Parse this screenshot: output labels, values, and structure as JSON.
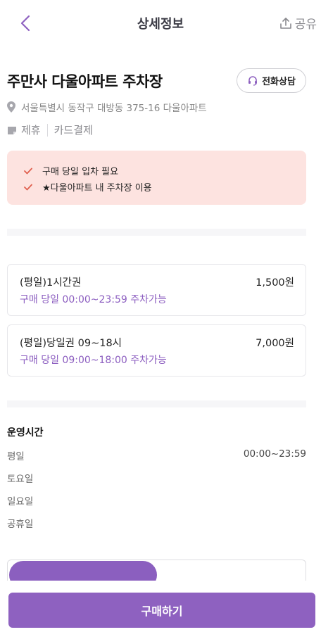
{
  "header": {
    "title": "상세정보",
    "share_label": "공유"
  },
  "place": {
    "name": "주만사 다울아파트 주차장",
    "call_label": "전화상담",
    "address": "서울특별시 동작구 대방동 375-16 다울아파트",
    "tags": [
      "제휴",
      "카드결제"
    ]
  },
  "notices": [
    "구매 당일 입차 필요",
    "★다울아파트 내 주차장 이용"
  ],
  "tickets": [
    {
      "name": "(평일)1시간권",
      "price": "1,500원",
      "desc": "구매 당일 00:00~23:59 주차가능"
    },
    {
      "name": "(평일)당일권 09~18시",
      "price": "7,000원",
      "desc": "구매 당일 09:00~18:00 주차가능"
    }
  ],
  "hours": {
    "title": "운영시간",
    "rows": [
      {
        "day": "평일",
        "time": "00:00~23:59"
      },
      {
        "day": "토요일",
        "time": ""
      },
      {
        "day": "일요일",
        "time": ""
      },
      {
        "day": "공휴일",
        "time": ""
      }
    ]
  },
  "buy_label": "구매하기",
  "colors": {
    "accent": "#8e61c0",
    "notice_bg": "#fde3e0",
    "check": "#e0604f"
  }
}
